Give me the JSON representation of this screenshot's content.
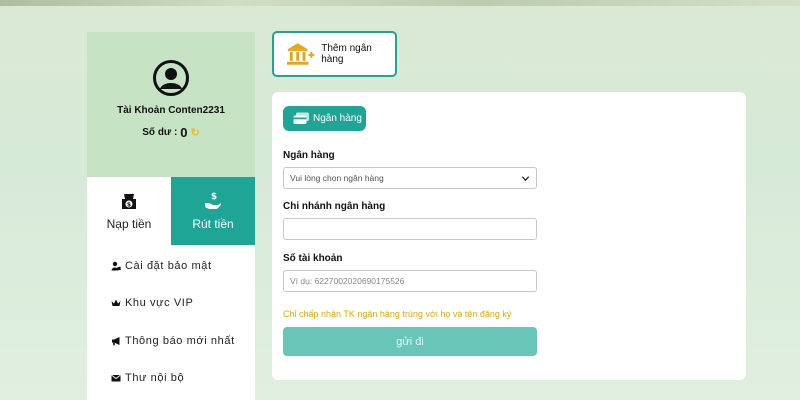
{
  "profile": {
    "account_name": "Tài Khoản Conten2231",
    "balance_label": "Số dư :",
    "balance_value": "0"
  },
  "tabs": {
    "deposit": "Nạp tiền",
    "withdraw": "Rút tiền"
  },
  "menu": {
    "items": [
      {
        "label": "Cài đặt bảo mật",
        "icon": "user-lock-icon"
      },
      {
        "label": "Khu vực VIP",
        "icon": "crown-icon"
      },
      {
        "label": "Thông báo mới nhất",
        "icon": "megaphone-icon"
      },
      {
        "label": "Thư nội bộ",
        "icon": "envelope-icon"
      }
    ]
  },
  "add_bank": {
    "label": "Thêm ngân hàng",
    "icon": "bank-plus-icon"
  },
  "form": {
    "tab_label": "Ngân hàng",
    "bank_label": "Ngân hàng",
    "bank_select": "Vui lòng chọn ngân hàng",
    "branch_label": "Chi nhánh ngân hàng",
    "branch_value": "",
    "account_label": "Số tài khoản",
    "account_placeholder": "Ví dụ: 6227002020690175526",
    "notice": "Chỉ chấp nhận TK ngân hàng trùng với họ và tên đăng ký",
    "submit_label": "gửi đi"
  },
  "colors": {
    "accent": "#1fa596",
    "submit": "#68c6b9",
    "notice": "#e7a800",
    "profile_bg": "#c6e3c4"
  }
}
